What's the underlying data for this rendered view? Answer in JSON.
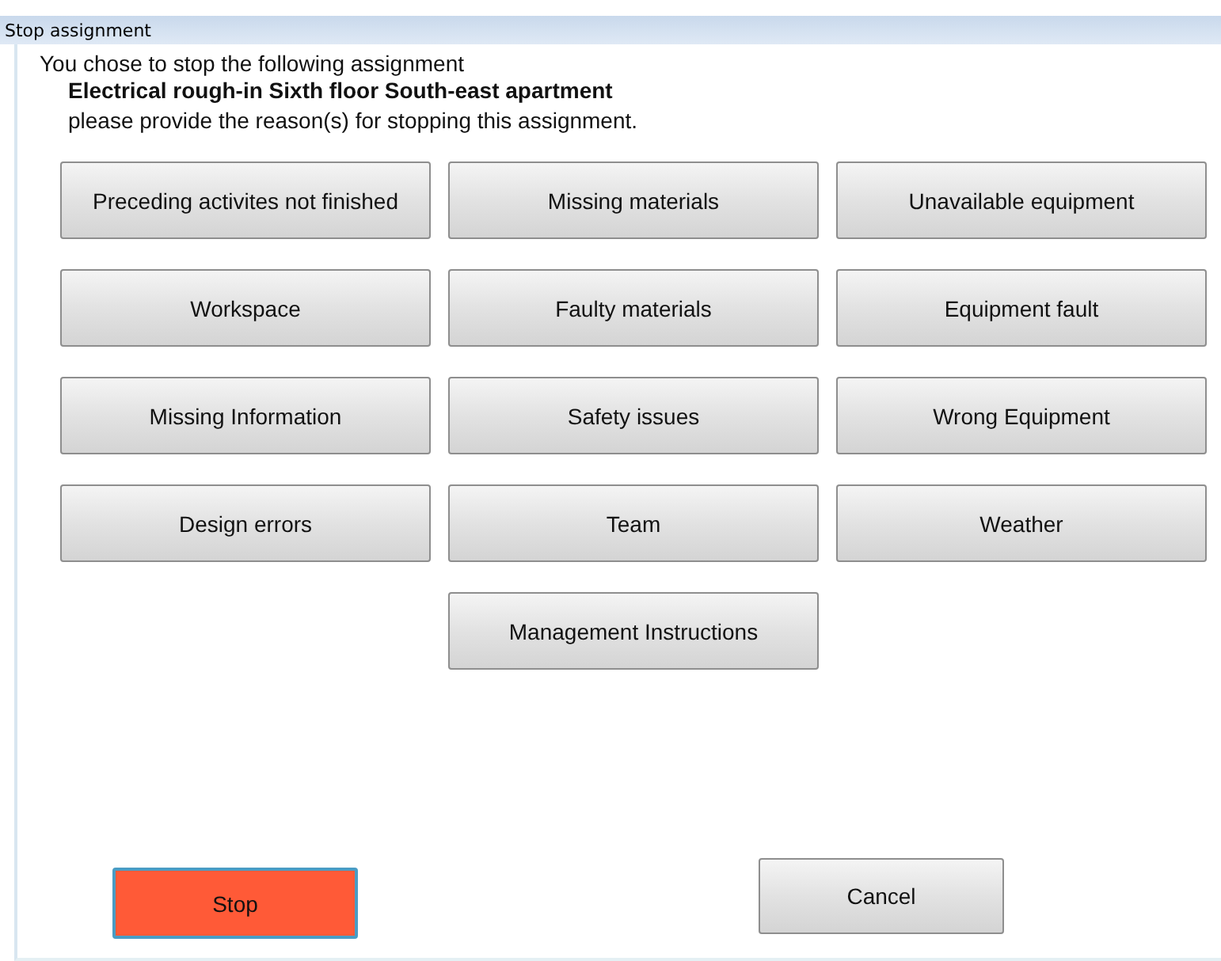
{
  "window": {
    "title": "Stop assignment"
  },
  "intro": "You chose to stop the following assignment",
  "assignment": "Electrical rough-in Sixth floor South-east apartment",
  "prompt": "please provide the reason(s) for stopping this assignment.",
  "reasons": [
    "Preceding activites not finished",
    "Missing materials",
    "Unavailable equipment",
    "Workspace",
    "Faulty materials",
    "Equipment fault",
    "Missing Information",
    "Safety issues",
    "Wrong Equipment",
    "Design errors",
    "Team",
    "Weather",
    "Management Instructions"
  ],
  "actions": [
    {
      "label": "Stop",
      "kind": "danger"
    },
    {
      "label": "Cancel",
      "kind": "normal"
    }
  ]
}
